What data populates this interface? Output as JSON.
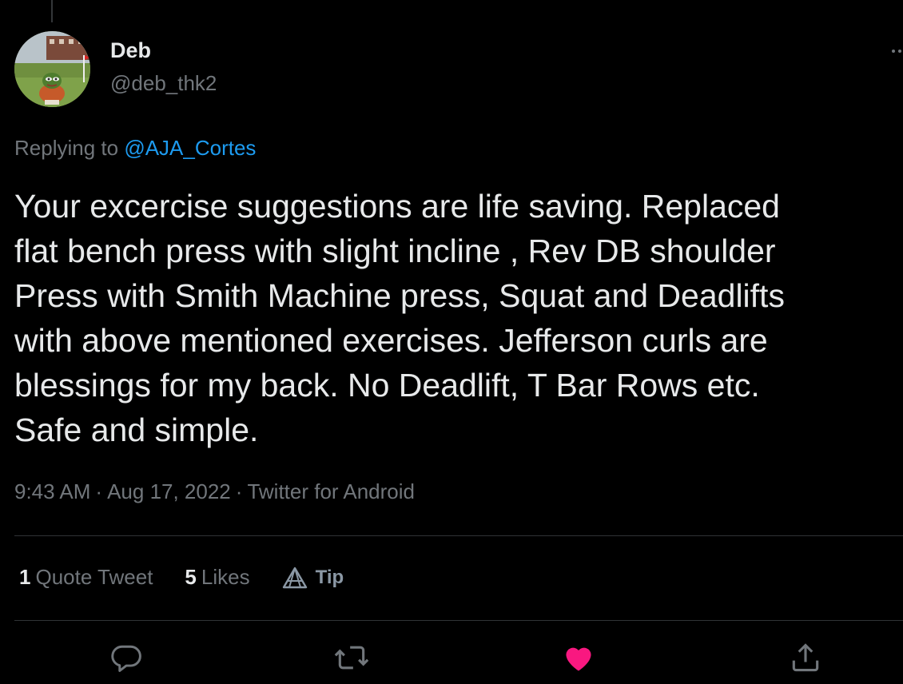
{
  "user": {
    "display_name": "Deb",
    "handle": "@deb_thk2",
    "avatar_icon": "avatar-image"
  },
  "replying": {
    "prefix": "Replying to",
    "mention": "@AJA_Cortes"
  },
  "tweet": {
    "text": "Your excercise suggestions are life saving. Replaced\nflat bench press with slight incline , Rev DB shoulder\nPress with Smith Machine press, Squat and Deadlifts\nwith above mentioned exercises. Jefferson curls are\nblessings for my back. No Deadlift, T Bar Rows etc.\nSafe and simple."
  },
  "meta": {
    "time": "9:43 AM",
    "separator": "·",
    "date": "Aug 17, 2022",
    "source": "Twitter for Android"
  },
  "stats": {
    "quote_count": "1",
    "quote_label": "Quote Tweet",
    "likes_count": "5",
    "likes_label": "Likes",
    "tip_label": "Tip"
  },
  "actions": {
    "reply_icon": "reply-icon",
    "retweet_icon": "retweet-icon",
    "like_icon": "like-icon",
    "share_icon": "share-icon"
  },
  "colors": {
    "background": "#000000",
    "text": "#e7e9ea",
    "secondary": "#71767b",
    "link": "#1d9bf0",
    "like": "#f91880",
    "divider": "#2f3336"
  }
}
